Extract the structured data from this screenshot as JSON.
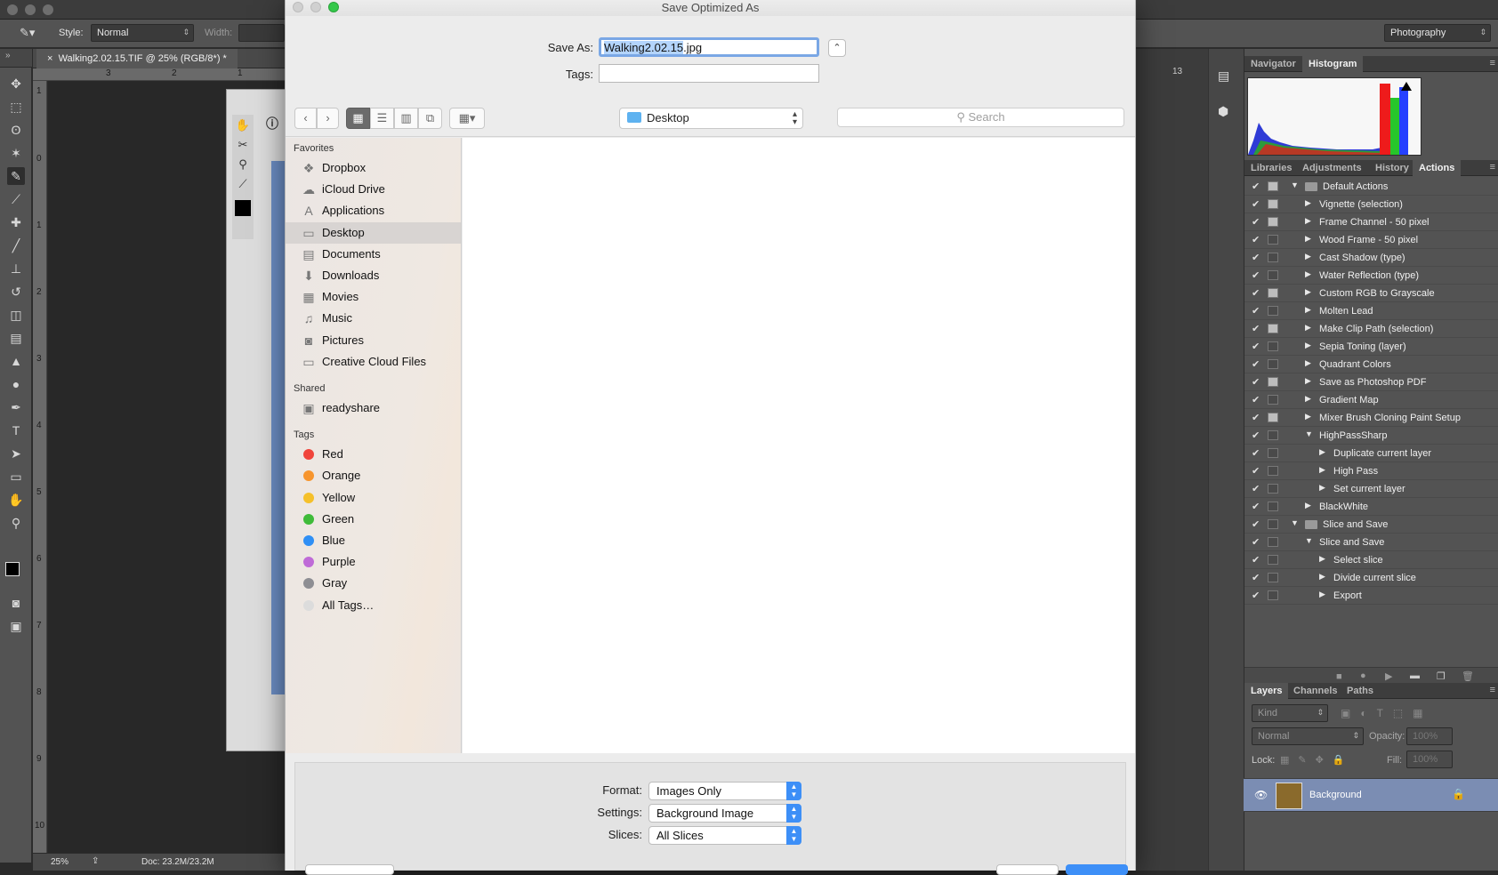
{
  "photoshop": {
    "options_bar": {
      "style_label": "Style:",
      "style_value": "Normal",
      "width_label": "Width:",
      "workspace": "Photography"
    },
    "document_tab": "Walking2.02.15.TIF @ 25% (RGB/8*) *",
    "ruler_top": [
      "3",
      "2",
      "1",
      "13"
    ],
    "ruler_left": [
      "1",
      "0",
      "1",
      "2",
      "3",
      "4",
      "5",
      "6",
      "7",
      "8",
      "9",
      "10"
    ],
    "status": {
      "zoom": "25%",
      "doc": "Doc: 23.2M/23.2M"
    },
    "panel_tabs_top": [
      "Navigator",
      "Histogram"
    ],
    "panel_tabs_mid": [
      "Libraries",
      "Adjustments",
      "History",
      "Actions"
    ],
    "actions": [
      {
        "label": "Default Actions",
        "level": 0,
        "type": "set",
        "open": true,
        "dialog": true
      },
      {
        "label": "Vignette (selection)",
        "level": 1,
        "type": "action",
        "open": false,
        "dialog": true
      },
      {
        "label": "Frame Channel - 50 pixel",
        "level": 1,
        "type": "action",
        "open": false,
        "dialog": true
      },
      {
        "label": "Wood Frame - 50 pixel",
        "level": 1,
        "type": "action",
        "open": false,
        "dialog": false
      },
      {
        "label": "Cast Shadow (type)",
        "level": 1,
        "type": "action",
        "open": false,
        "dialog": false
      },
      {
        "label": "Water Reflection (type)",
        "level": 1,
        "type": "action",
        "open": false,
        "dialog": false
      },
      {
        "label": "Custom RGB to Grayscale",
        "level": 1,
        "type": "action",
        "open": false,
        "dialog": true
      },
      {
        "label": "Molten Lead",
        "level": 1,
        "type": "action",
        "open": false,
        "dialog": false
      },
      {
        "label": "Make Clip Path (selection)",
        "level": 1,
        "type": "action",
        "open": false,
        "dialog": true
      },
      {
        "label": "Sepia Toning (layer)",
        "level": 1,
        "type": "action",
        "open": false,
        "dialog": false
      },
      {
        "label": "Quadrant Colors",
        "level": 1,
        "type": "action",
        "open": false,
        "dialog": false
      },
      {
        "label": "Save as Photoshop PDF",
        "level": 1,
        "type": "action",
        "open": false,
        "dialog": true
      },
      {
        "label": "Gradient Map",
        "level": 1,
        "type": "action",
        "open": false,
        "dialog": false
      },
      {
        "label": "Mixer Brush Cloning Paint Setup",
        "level": 1,
        "type": "action",
        "open": false,
        "dialog": true
      },
      {
        "label": "HighPassSharp",
        "level": 1,
        "type": "action",
        "open": true,
        "dialog": false
      },
      {
        "label": "Duplicate current layer",
        "level": 2,
        "type": "step",
        "open": false,
        "dialog": false
      },
      {
        "label": "High Pass",
        "level": 2,
        "type": "step",
        "open": false,
        "dialog": false
      },
      {
        "label": "Set current layer",
        "level": 2,
        "type": "step",
        "open": false,
        "dialog": false
      },
      {
        "label": "BlackWhite",
        "level": 1,
        "type": "action",
        "open": false,
        "dialog": false
      },
      {
        "label": "Slice and Save",
        "level": 0,
        "type": "set",
        "open": true,
        "dialog": false
      },
      {
        "label": "Slice and Save",
        "level": 1,
        "type": "action",
        "open": true,
        "dialog": false
      },
      {
        "label": "Select slice",
        "level": 2,
        "type": "step",
        "open": false,
        "dialog": false
      },
      {
        "label": "Divide current slice",
        "level": 2,
        "type": "step",
        "open": false,
        "dialog": false
      },
      {
        "label": "Export",
        "level": 2,
        "type": "step",
        "open": false,
        "dialog": false
      }
    ],
    "layers_tabs": [
      "Layers",
      "Channels",
      "Paths"
    ],
    "layers": {
      "kind": "Kind",
      "blend": "Normal",
      "opacity_label": "Opacity:",
      "opacity": "100%",
      "lock_label": "Lock:",
      "fill_label": "Fill:",
      "fill": "100%",
      "layer_name": "Background"
    }
  },
  "dialog": {
    "title": "Save Optimized As",
    "save_as_label": "Save As:",
    "filename_selected": "Walking2.02.15",
    "filename_ext": ".jpg",
    "tags_label": "Tags:",
    "tags_value": "",
    "location": "Desktop",
    "search_placeholder": "Search",
    "sidebar": {
      "favorites_header": "Favorites",
      "favorites": [
        {
          "label": "Dropbox",
          "icon": "dropbox-icon",
          "glyph": "❖"
        },
        {
          "label": "iCloud Drive",
          "icon": "cloud-icon",
          "glyph": "☁"
        },
        {
          "label": "Applications",
          "icon": "applications-icon",
          "glyph": "A"
        },
        {
          "label": "Desktop",
          "icon": "desktop-icon",
          "glyph": "▭"
        },
        {
          "label": "Documents",
          "icon": "documents-icon",
          "glyph": "▤"
        },
        {
          "label": "Downloads",
          "icon": "downloads-icon",
          "glyph": "⬇"
        },
        {
          "label": "Movies",
          "icon": "movies-icon",
          "glyph": "▦"
        },
        {
          "label": "Music",
          "icon": "music-icon",
          "glyph": "♫"
        },
        {
          "label": "Pictures",
          "icon": "pictures-icon",
          "glyph": "◙"
        },
        {
          "label": "Creative Cloud Files",
          "icon": "folder-icon",
          "glyph": "▭"
        }
      ],
      "selected": "Desktop",
      "shared_header": "Shared",
      "shared": [
        {
          "label": "readyshare",
          "icon": "network-computer-icon",
          "glyph": "▣"
        }
      ],
      "tags_header": "Tags",
      "tags": [
        {
          "label": "Red",
          "color": "#f0443a"
        },
        {
          "label": "Orange",
          "color": "#f7952d"
        },
        {
          "label": "Yellow",
          "color": "#f5c02a"
        },
        {
          "label": "Green",
          "color": "#3fbb39"
        },
        {
          "label": "Blue",
          "color": "#2f8ff5"
        },
        {
          "label": "Purple",
          "color": "#bf6bd7"
        },
        {
          "label": "Gray",
          "color": "#8e8e93"
        },
        {
          "label": "All Tags…",
          "color": "#dcdcdc"
        }
      ]
    },
    "options": {
      "format_label": "Format:",
      "format_value": "Images Only",
      "settings_label": "Settings:",
      "settings_value": "Background Image",
      "slices_label": "Slices:",
      "slices_value": "All Slices"
    }
  }
}
